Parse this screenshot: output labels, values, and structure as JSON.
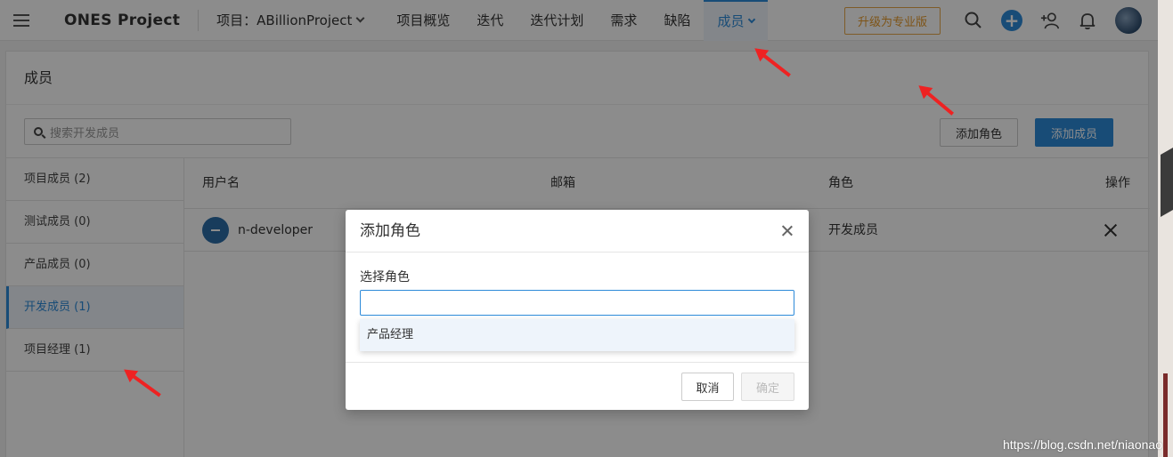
{
  "topbar": {
    "logo": "ONES Project",
    "project": "项目：ABillionProject",
    "nav": [
      "项目概览",
      "迭代",
      "迭代计划",
      "需求",
      "缺陷"
    ],
    "active_nav": "成员",
    "upgrade": "升级为专业版"
  },
  "card": {
    "title": "成员",
    "search_placeholder": "搜索开发成员",
    "add_role": "添加角色",
    "add_member": "添加成员"
  },
  "roles": [
    {
      "label": "项目成员 (2)"
    },
    {
      "label": "测试成员 (0)"
    },
    {
      "label": "产品成员 (0)"
    },
    {
      "label": "开发成员 (1)"
    },
    {
      "label": "项目经理 (1)"
    }
  ],
  "table": {
    "headers": {
      "username": "用户名",
      "email": "邮箱",
      "role": "角色",
      "action": "操作"
    },
    "rows": [
      {
        "username": "n-developer",
        "email": "",
        "role": "开发成员"
      }
    ]
  },
  "modal": {
    "title": "添加角色",
    "field_label": "选择角色",
    "input_value": "",
    "option": "产品经理",
    "cancel": "取消",
    "ok": "确定"
  },
  "watermark": "https://blog.csdn.net/niaonao",
  "colors": {
    "accent": "#2d8ad9",
    "upgrade": "#e59a2b",
    "annotation": "#e22222"
  }
}
